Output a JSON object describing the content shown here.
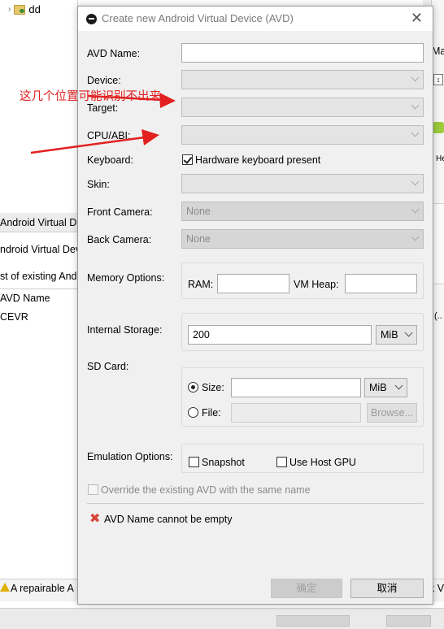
{
  "background": {
    "tree_item": "dd",
    "left_texts": [
      "Android Virtual D",
      "ndroid Virtual Dev",
      "st of existing And",
      "AVD Name",
      "CEVR"
    ],
    "right_texts": [
      "Ma",
      "He",
      "(.."
    ],
    "bottom_warning": "A repairable A",
    "bottom_right": "k V"
  },
  "dialog": {
    "title": "Create new Android Virtual Device (AVD)",
    "labels": {
      "avd_name": "AVD Name:",
      "device": "Device:",
      "target": "Target:",
      "cpu_abi": "CPU/ABI:",
      "keyboard": "Keyboard:",
      "skin": "Skin:",
      "front_camera": "Front Camera:",
      "back_camera": "Back Camera:",
      "memory_options": "Memory Options:",
      "ram": "RAM:",
      "vm_heap": "VM Heap:",
      "internal_storage": "Internal Storage:",
      "sd_card": "SD Card:",
      "size": "Size:",
      "file": "File:",
      "emulation_options": "Emulation Options:"
    },
    "values": {
      "avd_name": "",
      "front_camera": "None",
      "back_camera": "None",
      "internal_storage": "200",
      "internal_storage_unit": "MiB",
      "sd_size_unit": "MiB"
    },
    "keyboard_checkbox": "Hardware keyboard present",
    "snapshot": "Snapshot",
    "use_host_gpu": "Use Host GPU",
    "override": "Override the existing AVD with the same name",
    "error": "AVD Name cannot be empty",
    "browse": "Browse...",
    "ok": "确定",
    "cancel": "取消"
  },
  "annotation": {
    "text": "这几个位置可能识别不出来",
    "color": "#e32020"
  }
}
